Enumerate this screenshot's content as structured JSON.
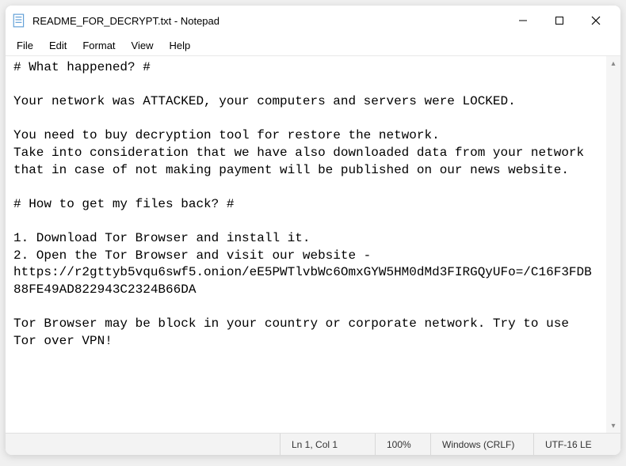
{
  "window": {
    "title": "README_FOR_DECRYPT.txt - Notepad"
  },
  "menu": {
    "file": "File",
    "edit": "Edit",
    "format": "Format",
    "view": "View",
    "help": "Help"
  },
  "content": {
    "text": "# What happened? #\n\nYour network was ATTACKED, your computers and servers were LOCKED.\n\nYou need to buy decryption tool for restore the network.\nTake into consideration that we have also downloaded data from your network that in case of not making payment will be published on our news website.\n\n# How to get my files back? #\n\n1. Download Tor Browser and install it.\n2. Open the Tor Browser and visit our website - https://r2gttyb5vqu6swf5.onion/eE5PWTlvbWc6OmxGYW5HM0dMd3FIRGQyUFo=/C16F3FDB88FE49AD822943C2324B66DA\n\nTor Browser may be block in your country or corporate network. Try to use Tor over VPN!"
  },
  "status": {
    "position": "Ln 1, Col 1",
    "zoom": "100%",
    "line_ending": "Windows (CRLF)",
    "encoding": "UTF-16 LE"
  }
}
